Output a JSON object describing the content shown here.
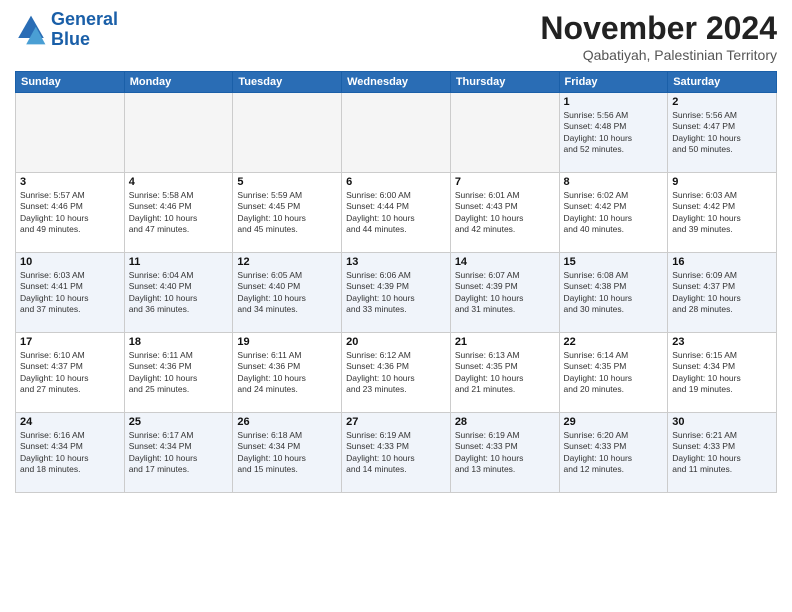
{
  "header": {
    "logo_line1": "General",
    "logo_line2": "Blue",
    "month": "November 2024",
    "location": "Qabatiyah, Palestinian Territory"
  },
  "days_of_week": [
    "Sunday",
    "Monday",
    "Tuesday",
    "Wednesday",
    "Thursday",
    "Friday",
    "Saturday"
  ],
  "weeks": [
    [
      {
        "num": "",
        "info": "",
        "empty": true
      },
      {
        "num": "",
        "info": "",
        "empty": true
      },
      {
        "num": "",
        "info": "",
        "empty": true
      },
      {
        "num": "",
        "info": "",
        "empty": true
      },
      {
        "num": "",
        "info": "",
        "empty": true
      },
      {
        "num": "1",
        "info": "Sunrise: 5:56 AM\nSunset: 4:48 PM\nDaylight: 10 hours\nand 52 minutes."
      },
      {
        "num": "2",
        "info": "Sunrise: 5:56 AM\nSunset: 4:47 PM\nDaylight: 10 hours\nand 50 minutes."
      }
    ],
    [
      {
        "num": "3",
        "info": "Sunrise: 5:57 AM\nSunset: 4:46 PM\nDaylight: 10 hours\nand 49 minutes."
      },
      {
        "num": "4",
        "info": "Sunrise: 5:58 AM\nSunset: 4:46 PM\nDaylight: 10 hours\nand 47 minutes."
      },
      {
        "num": "5",
        "info": "Sunrise: 5:59 AM\nSunset: 4:45 PM\nDaylight: 10 hours\nand 45 minutes."
      },
      {
        "num": "6",
        "info": "Sunrise: 6:00 AM\nSunset: 4:44 PM\nDaylight: 10 hours\nand 44 minutes."
      },
      {
        "num": "7",
        "info": "Sunrise: 6:01 AM\nSunset: 4:43 PM\nDaylight: 10 hours\nand 42 minutes."
      },
      {
        "num": "8",
        "info": "Sunrise: 6:02 AM\nSunset: 4:42 PM\nDaylight: 10 hours\nand 40 minutes."
      },
      {
        "num": "9",
        "info": "Sunrise: 6:03 AM\nSunset: 4:42 PM\nDaylight: 10 hours\nand 39 minutes."
      }
    ],
    [
      {
        "num": "10",
        "info": "Sunrise: 6:03 AM\nSunset: 4:41 PM\nDaylight: 10 hours\nand 37 minutes."
      },
      {
        "num": "11",
        "info": "Sunrise: 6:04 AM\nSunset: 4:40 PM\nDaylight: 10 hours\nand 36 minutes."
      },
      {
        "num": "12",
        "info": "Sunrise: 6:05 AM\nSunset: 4:40 PM\nDaylight: 10 hours\nand 34 minutes."
      },
      {
        "num": "13",
        "info": "Sunrise: 6:06 AM\nSunset: 4:39 PM\nDaylight: 10 hours\nand 33 minutes."
      },
      {
        "num": "14",
        "info": "Sunrise: 6:07 AM\nSunset: 4:39 PM\nDaylight: 10 hours\nand 31 minutes."
      },
      {
        "num": "15",
        "info": "Sunrise: 6:08 AM\nSunset: 4:38 PM\nDaylight: 10 hours\nand 30 minutes."
      },
      {
        "num": "16",
        "info": "Sunrise: 6:09 AM\nSunset: 4:37 PM\nDaylight: 10 hours\nand 28 minutes."
      }
    ],
    [
      {
        "num": "17",
        "info": "Sunrise: 6:10 AM\nSunset: 4:37 PM\nDaylight: 10 hours\nand 27 minutes."
      },
      {
        "num": "18",
        "info": "Sunrise: 6:11 AM\nSunset: 4:36 PM\nDaylight: 10 hours\nand 25 minutes."
      },
      {
        "num": "19",
        "info": "Sunrise: 6:11 AM\nSunset: 4:36 PM\nDaylight: 10 hours\nand 24 minutes."
      },
      {
        "num": "20",
        "info": "Sunrise: 6:12 AM\nSunset: 4:36 PM\nDaylight: 10 hours\nand 23 minutes."
      },
      {
        "num": "21",
        "info": "Sunrise: 6:13 AM\nSunset: 4:35 PM\nDaylight: 10 hours\nand 21 minutes."
      },
      {
        "num": "22",
        "info": "Sunrise: 6:14 AM\nSunset: 4:35 PM\nDaylight: 10 hours\nand 20 minutes."
      },
      {
        "num": "23",
        "info": "Sunrise: 6:15 AM\nSunset: 4:34 PM\nDaylight: 10 hours\nand 19 minutes."
      }
    ],
    [
      {
        "num": "24",
        "info": "Sunrise: 6:16 AM\nSunset: 4:34 PM\nDaylight: 10 hours\nand 18 minutes."
      },
      {
        "num": "25",
        "info": "Sunrise: 6:17 AM\nSunset: 4:34 PM\nDaylight: 10 hours\nand 17 minutes."
      },
      {
        "num": "26",
        "info": "Sunrise: 6:18 AM\nSunset: 4:34 PM\nDaylight: 10 hours\nand 15 minutes."
      },
      {
        "num": "27",
        "info": "Sunrise: 6:19 AM\nSunset: 4:33 PM\nDaylight: 10 hours\nand 14 minutes."
      },
      {
        "num": "28",
        "info": "Sunrise: 6:19 AM\nSunset: 4:33 PM\nDaylight: 10 hours\nand 13 minutes."
      },
      {
        "num": "29",
        "info": "Sunrise: 6:20 AM\nSunset: 4:33 PM\nDaylight: 10 hours\nand 12 minutes."
      },
      {
        "num": "30",
        "info": "Sunrise: 6:21 AM\nSunset: 4:33 PM\nDaylight: 10 hours\nand 11 minutes."
      }
    ]
  ]
}
